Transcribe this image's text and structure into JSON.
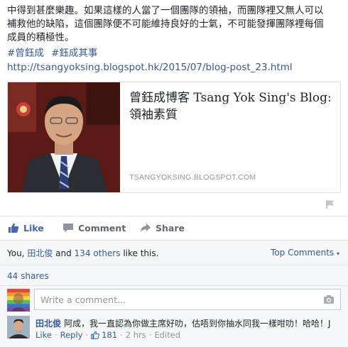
{
  "post": {
    "text_line1": "中得到甚麼樂趣。如果這樣的人當了一個團隊的領袖，而團隊裡又無人可以",
    "text_line2": "補救他的缺陷，這個團隊便不可能維持良好的士氣，不可能發揮團隊裡每個",
    "text_line3": "成員的積極性。",
    "hashtags": [
      "#曾鈺成",
      "#鈺成其事"
    ],
    "url": "http://tsangyoksing.blogspot.hk/2015/07/blog-post_23.html"
  },
  "link_card": {
    "title": "曾鈺成博客 Tsang Yok Sing's Blog: 領袖素質",
    "domain": "TSANGYOKSING.BLOGSPOT.COM",
    "image_icon": "portrait-photo"
  },
  "actions": {
    "like": "Like",
    "comment": "Comment",
    "share": "Share"
  },
  "feedback": {
    "likes_prefix": "You, ",
    "likes_friend": "田北俊",
    "likes_mid": " and ",
    "likes_others": "134 others",
    "likes_suffix": " like this.",
    "top_comments": "Top Comments",
    "shares": "44 shares",
    "composer_placeholder": "Write a comment..."
  },
  "comment": {
    "author": "田北俊",
    "text": "阿成，我一直認為你做主席好叻，估唔到你抽水同我一樣咁叻！哈哈！J",
    "like": "Like",
    "reply": "Reply",
    "like_count": "181",
    "time": "2 hrs",
    "edited": "Edited"
  },
  "colors": {
    "link": "#365899",
    "muted": "#90949c",
    "action": "#616770",
    "feedback_bg": "#f6f7f9"
  }
}
